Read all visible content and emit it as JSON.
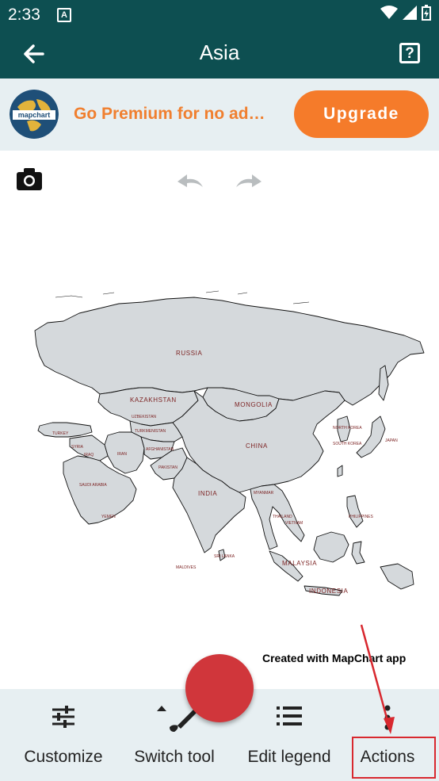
{
  "status_bar": {
    "time": "2:33",
    "notif_icon": "A"
  },
  "app_bar": {
    "title": "Asia"
  },
  "promo": {
    "text": "Go Premium for no ad…",
    "button_label": "Upgrade",
    "logo_text": "mapchart"
  },
  "map": {
    "labels": {
      "russia": "RUSSIA",
      "kazakhstan": "KAZAKHSTAN",
      "mongolia": "MONGOLIA",
      "china": "CHINA",
      "turkey": "TURKEY",
      "iran": "IRAN",
      "iraq": "IRAQ",
      "syria": "SYRIA",
      "saudi_arabia": "SAUDI ARABIA",
      "yemen": "YEMEN",
      "afghanistan": "AFGHANISTAN",
      "pakistan": "PAKISTAN",
      "turkmenistan": "TURKMENISTAN",
      "uzbekistan": "UZBEKISTAN",
      "india": "INDIA",
      "myanmar": "MYANMAR",
      "thailand": "THAILAND",
      "vietnam": "VIETNAM",
      "malaysia": "MALAYSIA",
      "indonesia": "INDONESIA",
      "philippines": "PHILIPPINES",
      "japan": "JAPAN",
      "north_korea": "NORTH KOREA",
      "south_korea": "SOUTH KOREA",
      "sri_lanka": "SRI LANKA",
      "maldives": "MALDIVES"
    },
    "fill_color": "#d5d9dc",
    "label_color": "#7d2424"
  },
  "credit": "Created with MapChart app",
  "bottom_nav": [
    {
      "label": "Customize"
    },
    {
      "label": "Switch tool"
    },
    {
      "label": "Edit legend"
    },
    {
      "label": "Actions"
    }
  ],
  "colors": {
    "primary": "#0d4f51",
    "accent": "#f57b2a",
    "fab": "#d0363b",
    "highlight": "#d8282f"
  }
}
